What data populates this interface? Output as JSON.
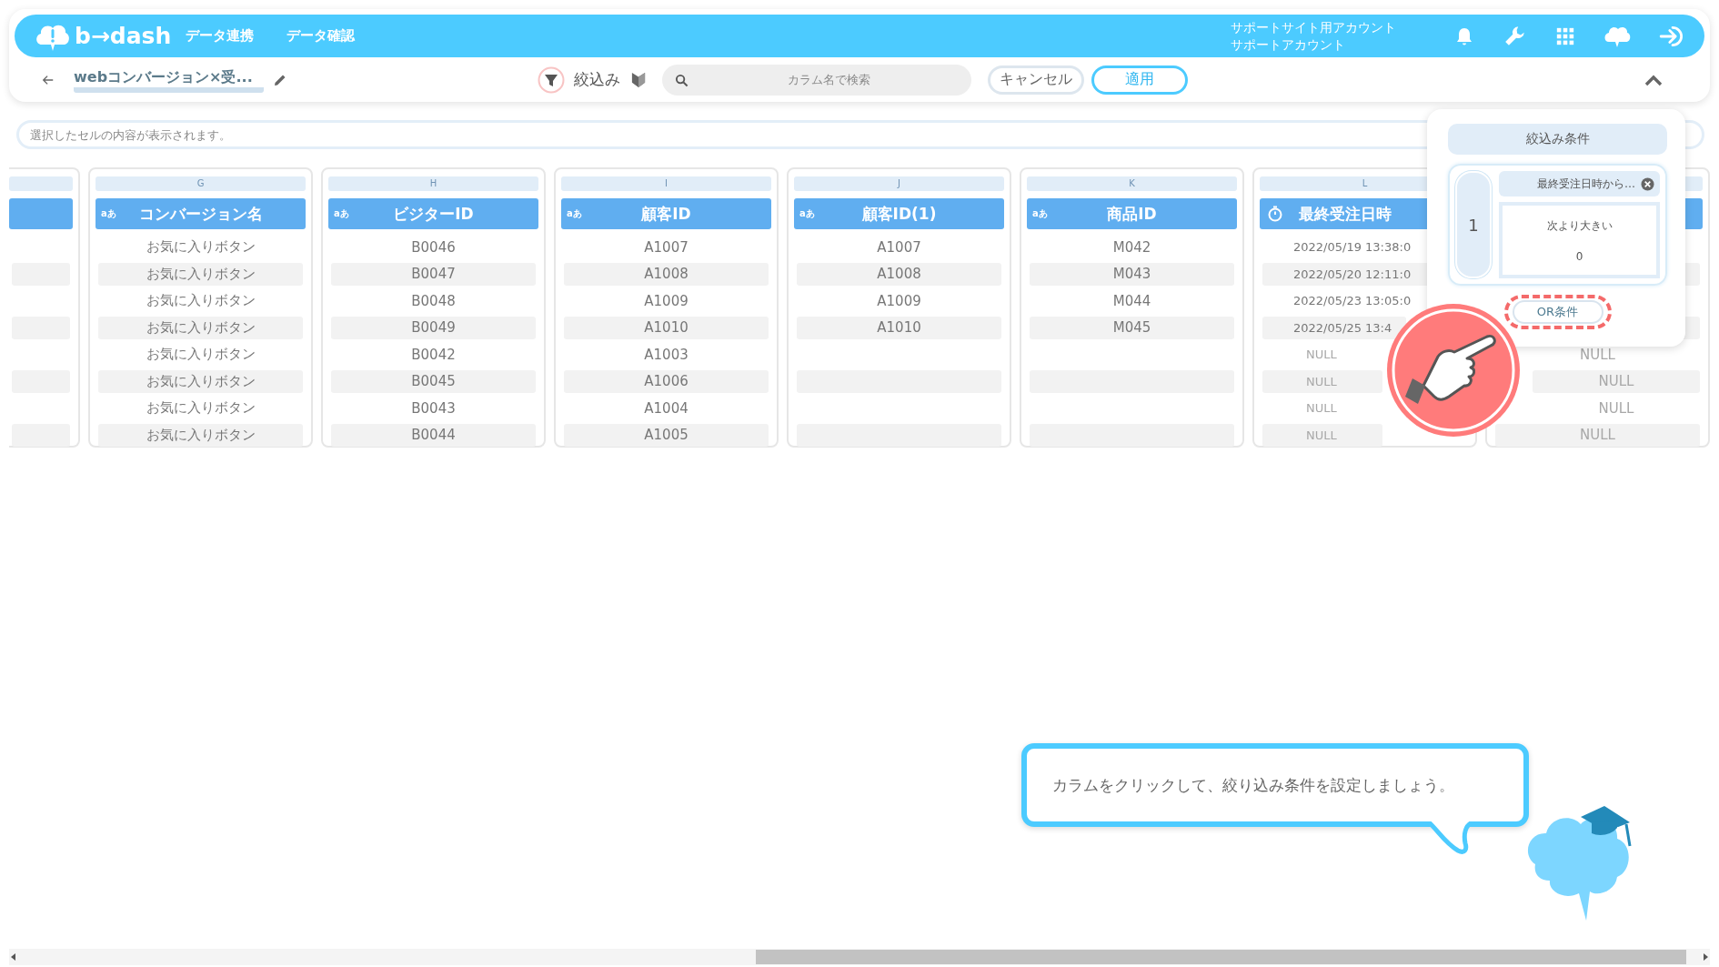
{
  "header": {
    "logo": "b→dash",
    "nav": [
      {
        "label": "データ連携"
      },
      {
        "label": "データ確認"
      }
    ],
    "account": [
      "サポートサイト用アカウント",
      "サポートアカウント"
    ]
  },
  "toolbar": {
    "title": "webコンバージョン×受...",
    "filter_label": "絞込み",
    "search": {
      "placeholder": "カラム名で検索"
    },
    "buttons": [
      {
        "label": "キャンセル",
        "kind": "secondary"
      },
      {
        "label": "適用",
        "kind": "primary"
      }
    ]
  },
  "cell_viewer": {
    "placeholder": "選択したセルの内容が表示されます。"
  },
  "columns": [
    {
      "kind": "stub",
      "cells": [
        null,
        null,
        null,
        null,
        null,
        null,
        null,
        null
      ]
    },
    {
      "kind": "text",
      "letter": "G",
      "type_label": "aあ",
      "name": "コンバージョン名",
      "cells": [
        "お気に入りボタン",
        "お気に入りボタン",
        "お気に入りボタン",
        "お気に入りボタン",
        "お気に入りボタン",
        "お気に入りボタン",
        "お気に入りボタン",
        "お気に入りボタン"
      ]
    },
    {
      "kind": "text",
      "letter": "H",
      "type_label": "aあ",
      "name": "ビジターID",
      "cells": [
        "B0046",
        "B0047",
        "B0048",
        "B0049",
        "B0042",
        "B0045",
        "B0043",
        "B0044"
      ]
    },
    {
      "kind": "text",
      "letter": "I",
      "type_label": "aあ",
      "name": "顧客ID",
      "cells": [
        "A1007",
        "A1008",
        "A1009",
        "A1010",
        "A1003",
        "A1006",
        "A1004",
        "A1005"
      ]
    },
    {
      "kind": "text",
      "letter": "J",
      "type_label": "aあ",
      "name": "顧客ID(1)",
      "cells": [
        "A1007",
        "A1008",
        "A1009",
        "A1010",
        null,
        null,
        null,
        null
      ]
    },
    {
      "kind": "text",
      "letter": "K",
      "type_label": "aあ",
      "name": "商品ID",
      "cells": [
        "M042",
        "M043",
        "M044",
        "M045",
        null,
        null,
        null,
        null
      ]
    },
    {
      "kind": "datetime",
      "letter": "L",
      "name": "最終受注日時",
      "cells": [
        "2022/05/19 13:38:0",
        "2022/05/20 12:11:0",
        "2022/05/23 13:05:0",
        "2022/05/25 13:4",
        {
          "text": "NULL",
          "kind": "null"
        },
        {
          "text": "NULL",
          "kind": "null"
        },
        {
          "text": "NULL",
          "kind": "null"
        },
        {
          "text": "NULL",
          "kind": "null"
        }
      ]
    },
    {
      "kind": "covered",
      "cells": [
        null,
        null,
        null,
        null,
        {
          "text": "NULL",
          "kind": "null"
        },
        {
          "text": "NULL",
          "kind": "null"
        },
        {
          "text": "NULL",
          "kind": "null"
        },
        {
          "text": "NULL",
          "kind": "null"
        }
      ]
    }
  ],
  "filter_panel": {
    "title": "絞込み条件",
    "groups": [
      {
        "number": "1",
        "conditions": [
          {
            "column": "最終受注日時から…",
            "operator": "次より大きい",
            "value": "0"
          }
        ]
      }
    ],
    "or_button": {
      "label": "OR条件",
      "highlighted": true
    }
  },
  "tutorial": {
    "message": "カラムをクリックして、絞り込み条件を設定しましょう。"
  }
}
